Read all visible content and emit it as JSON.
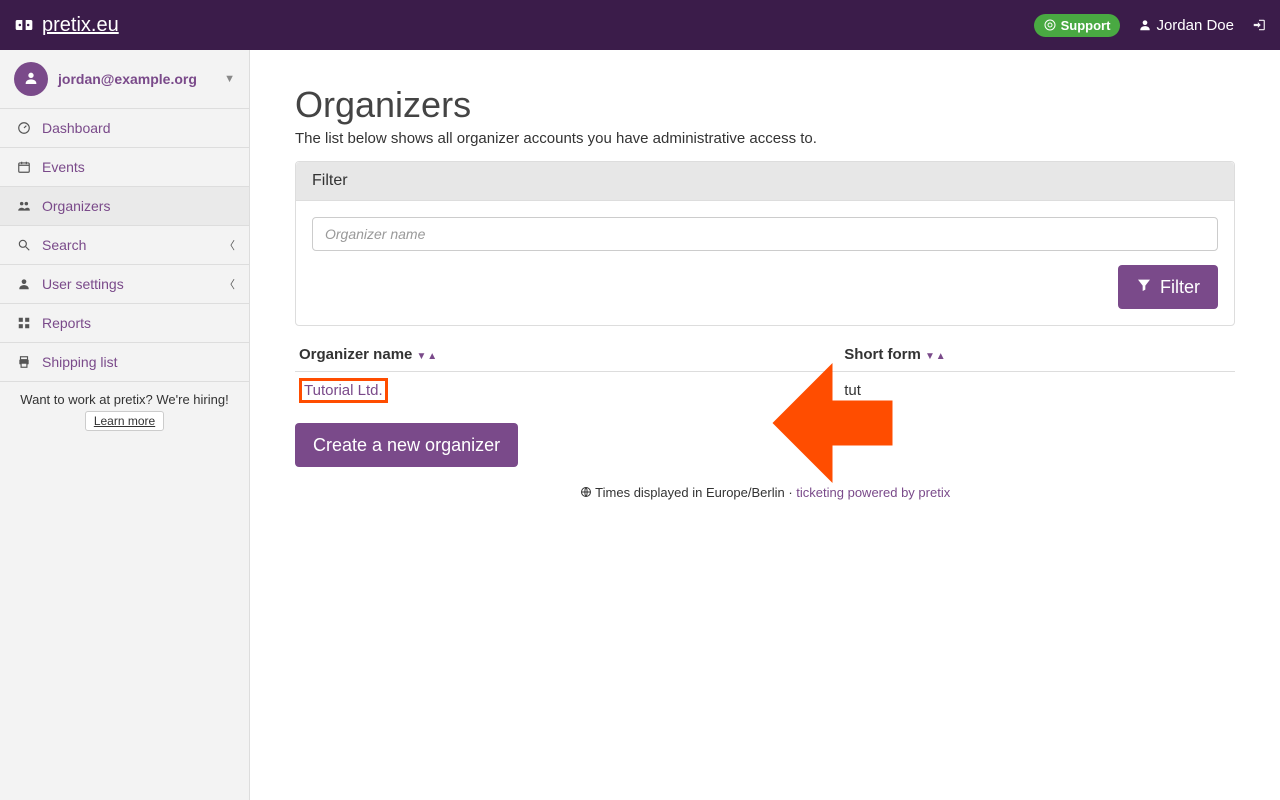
{
  "navbar": {
    "brand": "pretix.eu",
    "support_label": "Support",
    "user_name": "Jordan Doe"
  },
  "sidebar": {
    "email": "jordan@example.org",
    "items": [
      {
        "key": "dashboard",
        "label": "Dashboard",
        "icon": "dashboard"
      },
      {
        "key": "events",
        "label": "Events",
        "icon": "calendar"
      },
      {
        "key": "organizers",
        "label": "Organizers",
        "icon": "users",
        "active": true
      },
      {
        "key": "search",
        "label": "Search",
        "icon": "search",
        "expandable": true
      },
      {
        "key": "usersettings",
        "label": "User settings",
        "icon": "user",
        "expandable": true
      },
      {
        "key": "reports",
        "label": "Reports",
        "icon": "th"
      },
      {
        "key": "shipping",
        "label": "Shipping list",
        "icon": "print"
      }
    ],
    "hiring_text": "Want to work at pretix? We're hiring!",
    "learn_more": "Learn more"
  },
  "page": {
    "title": "Organizers",
    "description": "The list below shows all organizer accounts you have administrative access to."
  },
  "filter": {
    "heading": "Filter",
    "placeholder": "Organizer name",
    "button": "Filter"
  },
  "table": {
    "col_name": "Organizer name",
    "col_short": "Short form",
    "rows": [
      {
        "name": "Tutorial Ltd.",
        "short": "tut"
      }
    ]
  },
  "create_button": "Create a new organizer",
  "footer": {
    "tz_text": "Times displayed in Europe/Berlin",
    "sep": " · ",
    "credit_text": "ticketing powered by pretix"
  }
}
